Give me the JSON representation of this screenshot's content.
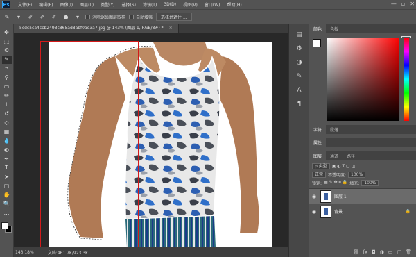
{
  "app": {
    "logo": "Ps"
  },
  "menu": [
    "文件(F)",
    "编辑(E)",
    "图像(I)",
    "图层(L)",
    "类型(Y)",
    "选择(S)",
    "滤镜(T)",
    "3D(D)",
    "视图(V)",
    "窗口(W)",
    "帮助(H)"
  ],
  "window_controls": [
    "—",
    "▫",
    "✕"
  ],
  "options": {
    "check1": "消除锯齿图层取样",
    "check2": "自动增强",
    "select_button": "选择并遮住 ..."
  },
  "document": {
    "tab_title": "5cdc5ca4ccb2493c865ad8abf0ae3a7.jpg @ 143% (图层 1, RGB/8#) *",
    "zoom": "143.18%",
    "doc_info": "文档:461.7K/923.3K"
  },
  "panels": {
    "color_tab": "颜色",
    "swatches_tab": "色板",
    "char_tab": "字符",
    "para_tab": "段落",
    "props_tab": "属性",
    "layers_tab": "图层",
    "channels_tab": "通道",
    "paths_tab": "路径",
    "kind_label": "ρ 类型",
    "blend_mode": "正常",
    "opacity_label": "不透明度:",
    "opacity_value": "100%",
    "lock_label": "锁定:",
    "fill_label": "填充:",
    "fill_value": "100%",
    "layers": [
      {
        "name": "图层 1",
        "selected": true
      },
      {
        "name": "背景",
        "selected": false
      }
    ]
  },
  "colors": {
    "accent": "#31a8ff",
    "highlight": "#d31a1a"
  }
}
